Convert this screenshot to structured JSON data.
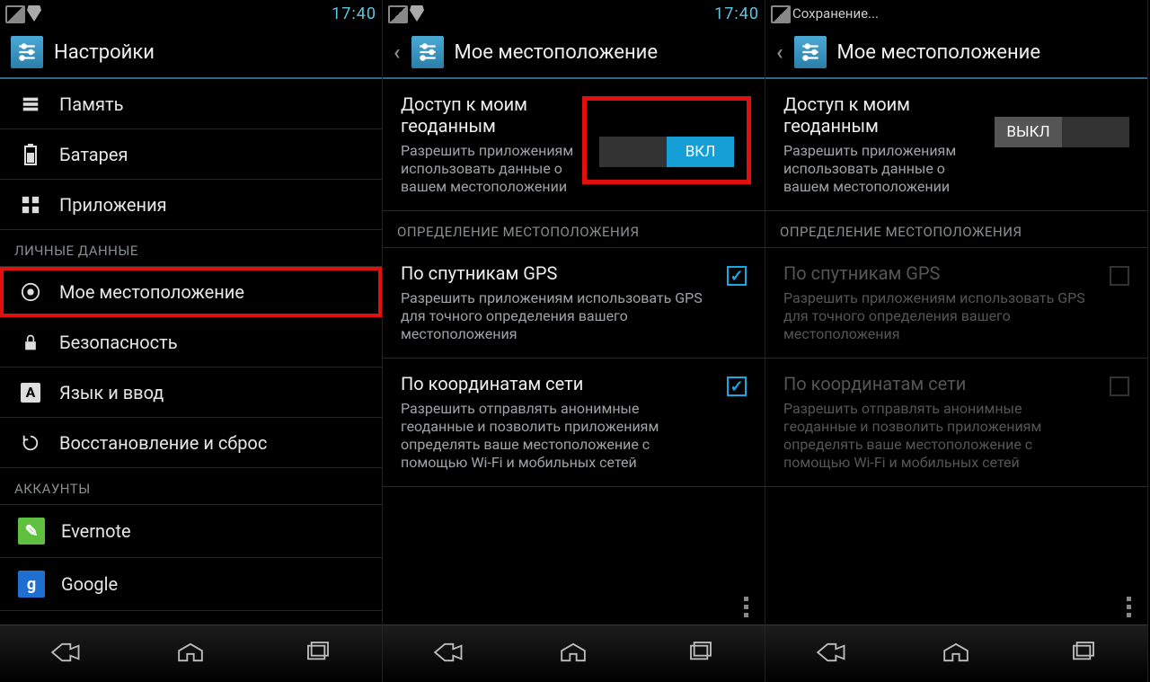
{
  "status": {
    "time": "17:40",
    "saving_label": "Сохранение..."
  },
  "settings": {
    "title": "Настройки",
    "items": {
      "memory": "Память",
      "battery": "Батарея",
      "apps": "Приложения",
      "location": "Мое местоположение",
      "security": "Безопасность",
      "language": "Язык и ввод",
      "backup": "Восстановление и сброс"
    },
    "section_personal": "ЛИЧНЫЕ ДАННЫЕ",
    "section_accounts": "АККАУНТЫ",
    "accounts": {
      "evernote": "Evernote",
      "google": "Google"
    }
  },
  "location": {
    "header": "Мое местоположение",
    "access_title": "Доступ к моим геоданным",
    "access_sub": "Разрешить приложениям использовать данные о вашем местоположении",
    "toggle_on": "ВКЛ",
    "toggle_off": "ВЫКЛ",
    "section_detect": "ОПРЕДЕЛЕНИЕ МЕСТОПОЛОЖЕНИЯ",
    "gps_title": "По спутникам GPS",
    "gps_sub": "Разрешить приложениям использовать GPS для точного определения вашего местоположения",
    "net_title": "По координатам сети",
    "net_sub": "Разрешить отправлять анонимные геоданные и позволить приложениям определять ваше местоположение с помощью Wi-Fi и мобильных сетей"
  }
}
